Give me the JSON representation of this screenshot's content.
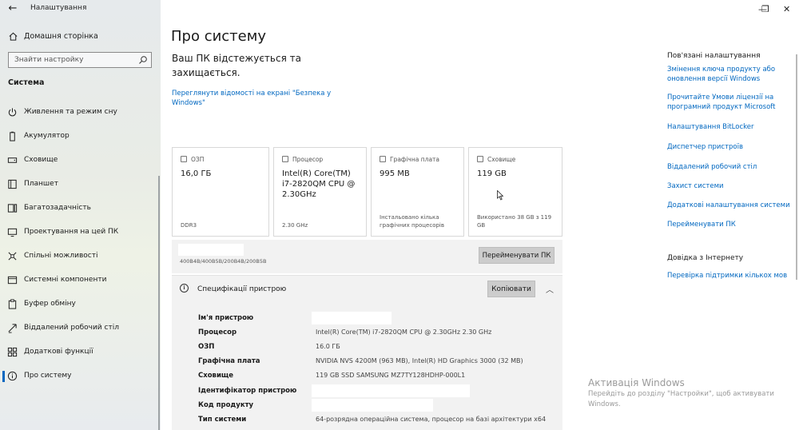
{
  "window": {
    "app_title": "Налаштування",
    "controls": {
      "minimize": "—",
      "maximize": "❐",
      "close": "✕"
    }
  },
  "sidebar": {
    "home_label": "Домашня сторінка",
    "search_placeholder": "Знайти настройку",
    "section_title": "Система",
    "items": [
      {
        "label": "Живлення та режим сну",
        "icon": "power-icon"
      },
      {
        "label": "Акумулятор",
        "icon": "battery-icon"
      },
      {
        "label": "Сховище",
        "icon": "storage-icon"
      },
      {
        "label": "Планшет",
        "icon": "tablet-icon"
      },
      {
        "label": "Багатозадачність",
        "icon": "multitasking-icon"
      },
      {
        "label": "Проектування на цей ПК",
        "icon": "projecting-icon"
      },
      {
        "label": "Спільні можливості",
        "icon": "shared-experiences-icon"
      },
      {
        "label": "Системні компоненти",
        "icon": "system-components-icon"
      },
      {
        "label": "Буфер обміну",
        "icon": "clipboard-icon"
      },
      {
        "label": "Віддалений робочий стіл",
        "icon": "remote-desktop-icon"
      },
      {
        "label": "Додаткові функції",
        "icon": "optional-features-icon"
      },
      {
        "label": "Про систему",
        "icon": "info-icon",
        "active": true
      }
    ]
  },
  "main": {
    "title": "Про систему",
    "protection_text": "Ваш ПК відстежується та захищається.",
    "security_link": "Переглянути відомості на екрані \"Безпека у Windows\"",
    "cards": [
      {
        "header": "ОЗП",
        "value": "16,0 ГБ",
        "footer": "DDR3"
      },
      {
        "header": "Процесор",
        "value": "Intel(R) Core(TM) i7-2820QM CPU @ 2.30GHz",
        "footer": "2.30 GHz"
      },
      {
        "header": "Графічна плата",
        "value": "995 MB",
        "footer": "Інстальовано кілька графічних процесорів"
      },
      {
        "header": "Сховище",
        "value": "119 GB",
        "footer": "Використано 38 GB з 119 GB"
      }
    ],
    "device_subtitle": "400B4B/400B5B/200B4B/200B5B",
    "rename_button": "Перейменувати ПК",
    "specs": {
      "title": "Специфікації пристрою",
      "copy_button": "Копіювати",
      "rows": [
        {
          "key": "Ім'я пристрою",
          "value": ""
        },
        {
          "key": "Процесор",
          "value": "Intel(R) Core(TM) i7-2820QM CPU @ 2.30GHz   2.30 GHz"
        },
        {
          "key": "ОЗП",
          "value": "16.0 ГБ"
        },
        {
          "key": "Графічна плата",
          "value": "NVIDIA NVS 4200M (963 MB), Intel(R) HD Graphics 3000 (32 MB)"
        },
        {
          "key": "Сховище",
          "value": "119 GB SSD SAMSUNG MZ7TY128HDHP-000L1"
        },
        {
          "key": "Ідентифікатор пристрою",
          "value": ""
        },
        {
          "key": "Код продукту",
          "value": ""
        },
        {
          "key": "Тип системи",
          "value": "64-розрядна операційна система, процесор на базі архітектури x64"
        }
      ]
    }
  },
  "related": {
    "title": "Пов'язані налаштування",
    "links": [
      "Змінення ключа продукту або оновлення версії Windows",
      "Прочитайте Умови ліцензії на програмний продукт Microsoft",
      "Налаштування BitLocker",
      "Диспетчер пристроїв",
      "Віддалений робочий стіл",
      "Захист системи",
      "Додаткові налаштування системи",
      "Перейменувати ПК"
    ],
    "help_title": "Довідка з Інтернету",
    "help_links": [
      "Перевірка підтримки кількох мов"
    ]
  },
  "watermark": {
    "title": "Активація Windows",
    "subtitle": "Перейдіть до розділу \"Настройки\", щоб активувати Windows."
  },
  "colors": {
    "accent": "#0067c0",
    "sidebar_bg": "#e8ebe9",
    "card_border": "#d8d8d8",
    "button_bg": "#cccccc"
  }
}
